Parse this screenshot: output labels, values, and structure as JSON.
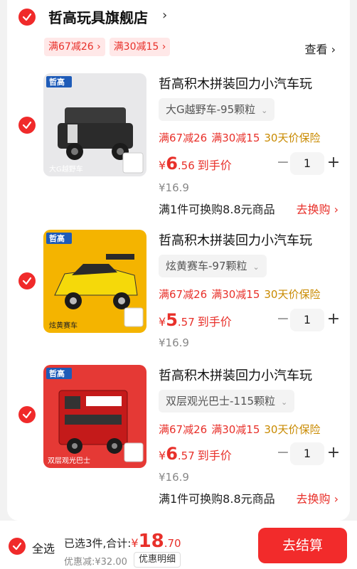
{
  "shop": {
    "name": "哲高玩具旗舰店",
    "chevron": "›",
    "coupons": [
      "满67减26 ›",
      "满30减15 ›"
    ],
    "view_more": "查看 ›"
  },
  "items": [
    {
      "title": "哲高积木拼装回力小汽车玩",
      "sku": "大G越野车-95颗粒",
      "promo1": "满67减26",
      "promo2": "满30减15",
      "promo3": "30天价保险",
      "price_yen": "¥",
      "price_int": "6",
      "price_dec": ".56",
      "price_tag": "到手价",
      "orig_price": "¥16.9",
      "qty": "1",
      "redeem": "满1件可换购8.8元商品",
      "redeem_link": "去换购 ›",
      "thumb_label": "大G越野车",
      "thumb_brand": "哲高",
      "car_color": "#3a3a3a",
      "bg_color": "#e8e8ea"
    },
    {
      "title": "哲高积木拼装回力小汽车玩",
      "sku": "炫黄赛车-97颗粒",
      "promo1": "满67减26",
      "promo2": "满30减15",
      "promo3": "30天价保险",
      "price_yen": "¥",
      "price_int": "5",
      "price_dec": ".57",
      "price_tag": "到手价",
      "orig_price": "¥16.9",
      "qty": "1",
      "thumb_label": "炫黄赛车",
      "thumb_brand": "哲高",
      "car_color": "#f5d90a",
      "bg_color": "#f4b400"
    },
    {
      "title": "哲高积木拼装回力小汽车玩",
      "sku": "双层观光巴士-115颗粒",
      "promo1": "满67减26",
      "promo2": "满30减15",
      "promo3": "30天价保险",
      "price_yen": "¥",
      "price_int": "6",
      "price_dec": ".57",
      "price_tag": "到手价",
      "orig_price": "¥16.9",
      "qty": "1",
      "redeem": "满1件可换购8.8元商品",
      "redeem_link": "去换购 ›",
      "thumb_label": "双层观光巴士",
      "thumb_brand": "哲高",
      "car_color": "#d11f1f",
      "bg_color": "#e53935"
    }
  ],
  "stepper": {
    "minus": "−",
    "plus": "+"
  },
  "sku_caret": "⌄",
  "bottom": {
    "select_all": "全选",
    "selected": "已选3件,合计:",
    "total_yen": "¥",
    "total_int": "18",
    "total_dec": ".70",
    "discount": "优惠减:¥32.00",
    "detail_button": "优惠明细",
    "checkout": "去结算"
  },
  "colors": {
    "accent": "#f02a2a",
    "gold": "#c98a00"
  }
}
